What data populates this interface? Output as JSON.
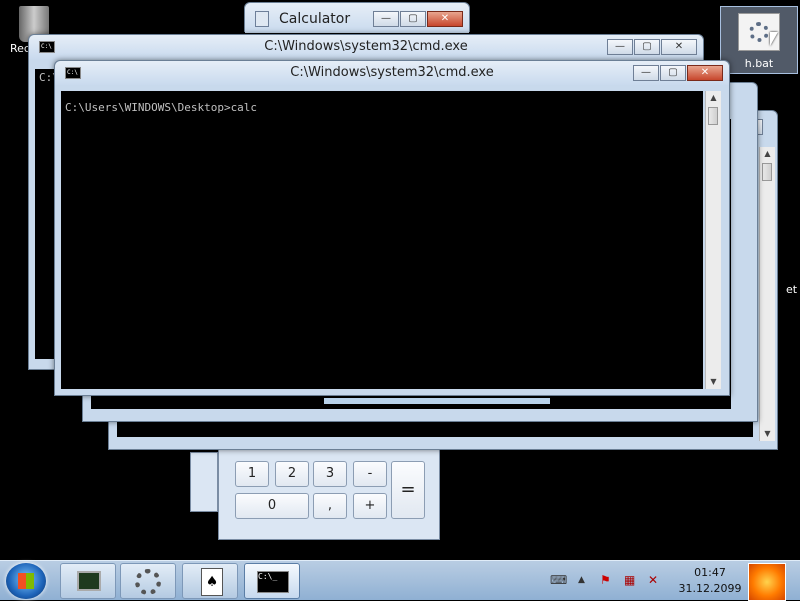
{
  "desktop": {
    "recycle_label": "Rec",
    "hbat_label": "h.bat",
    "right_fragment": "et"
  },
  "calculator": {
    "title": "Calculator",
    "keys": [
      "1",
      "2",
      "3",
      "-",
      "0",
      ",",
      "+",
      "="
    ]
  },
  "cmd_back": {
    "title": "C:\\Windows\\system32\\cmd.exe",
    "prompt_fragment": "C:\\"
  },
  "cmd_front": {
    "title": "C:\\Windows\\system32\\cmd.exe",
    "line": "C:\\Users\\WINDOWS\\Desktop>calc"
  },
  "window_buttons": {
    "minimize": "—",
    "maximize": "▢",
    "close": "✕"
  },
  "taskbar": {
    "time": "01:47",
    "date": "31.12.2099"
  }
}
